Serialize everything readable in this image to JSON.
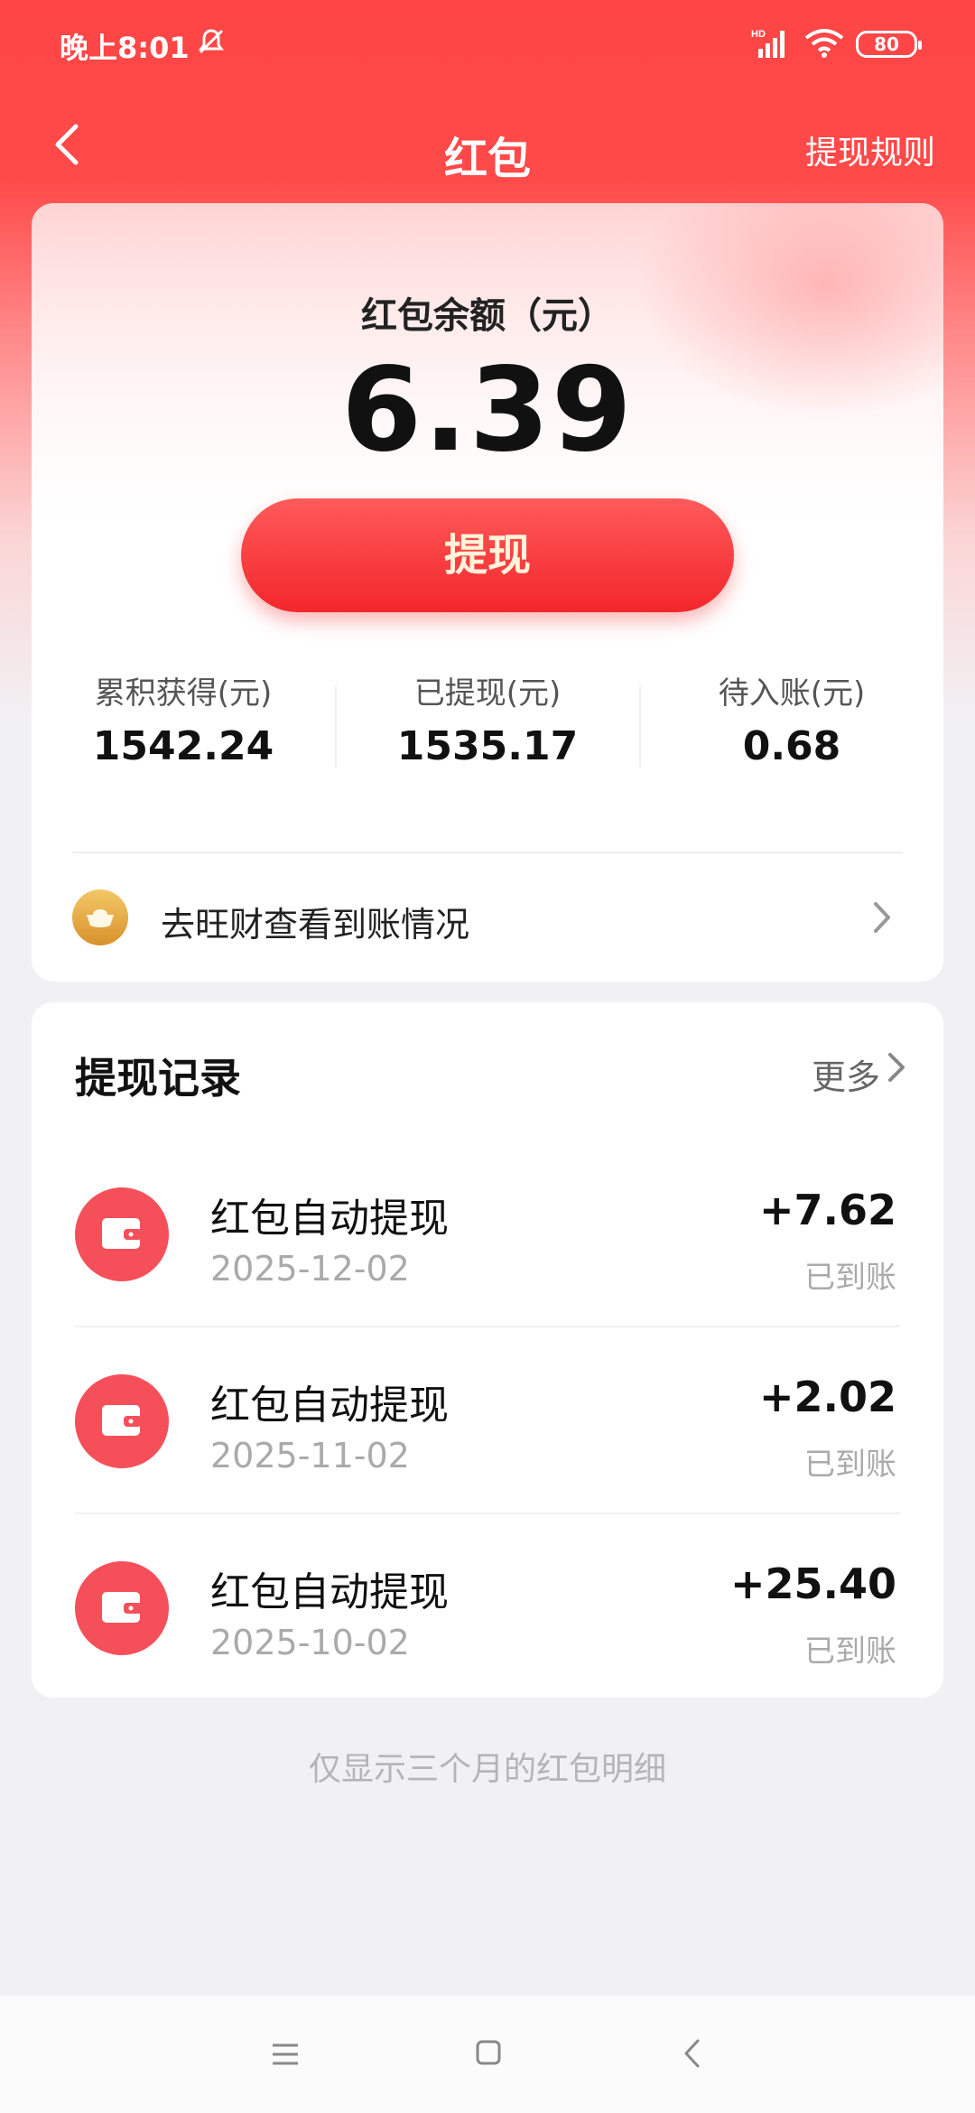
{
  "status_bar": {
    "time": "晚上8:01",
    "battery": "80"
  },
  "nav": {
    "title": "红包",
    "rules_label": "提现规则"
  },
  "balance": {
    "label": "红包余额（元）",
    "amount": "6.39",
    "withdraw_label": "提现",
    "stats": [
      {
        "label": "累积获得(元)",
        "value": "1542.24"
      },
      {
        "label": "已提现(元)",
        "value": "1535.17"
      },
      {
        "label": "待入账(元)",
        "value": "0.68"
      }
    ],
    "check_link": "去旺财查看到账情况"
  },
  "records": {
    "title": "提现记录",
    "more_label": "更多",
    "items": [
      {
        "title": "红包自动提现",
        "date": "2025-12-02",
        "amount": "+7.62",
        "status": "已到账"
      },
      {
        "title": "红包自动提现",
        "date": "2025-11-02",
        "amount": "+2.02",
        "status": "已到账"
      },
      {
        "title": "红包自动提现",
        "date": "2025-10-02",
        "amount": "+25.40",
        "status": "已到账"
      }
    ]
  },
  "footer_note": "仅显示三个月的红包明细",
  "colors": {
    "primary_red": "#ff4545",
    "button_red": "#f2272c",
    "icon_red": "#f5505a",
    "gold": "#e0a53a"
  },
  "icons": {
    "back": "chevron-left-icon",
    "gold": "gold-ingot-icon",
    "wallet": "wallet-icon"
  }
}
